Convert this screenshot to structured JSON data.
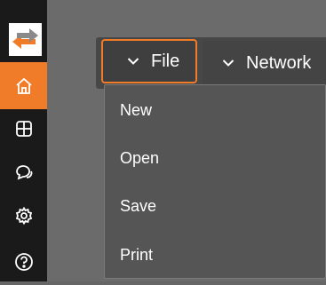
{
  "sidebar": {
    "logo_icon": "arrows-exchange-logo",
    "items": [
      {
        "icon": "home-icon",
        "active": true
      },
      {
        "icon": "grid-icon",
        "active": false
      },
      {
        "icon": "chat-icon",
        "active": false
      },
      {
        "icon": "gear-icon",
        "active": false
      },
      {
        "icon": "help-icon",
        "active": false
      }
    ]
  },
  "menubar": {
    "file_label": "File",
    "network_label": "Network"
  },
  "dropdown": {
    "items": [
      "New",
      "Open",
      "Save",
      "Print"
    ]
  },
  "colors": {
    "accent": "#f07c2a",
    "sidebar": "#1a1a1a",
    "background": "#6b6b6b",
    "menu": "#474747",
    "dropdown": "#555555"
  }
}
